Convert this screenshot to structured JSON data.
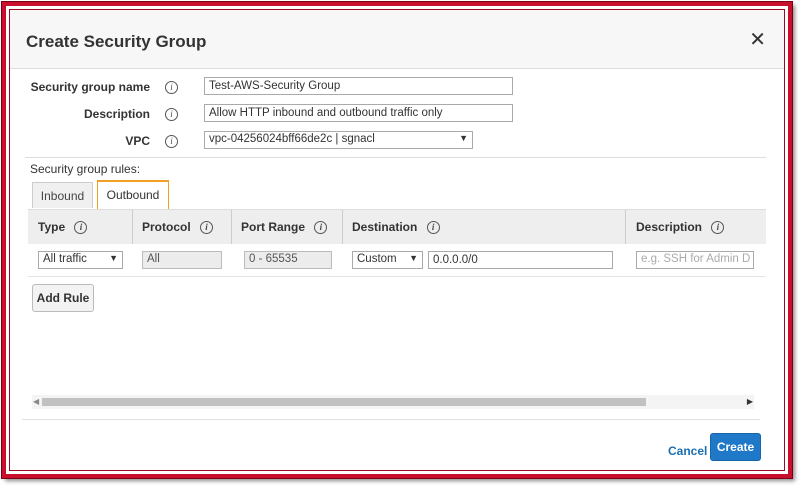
{
  "dialog": {
    "title": "Create Security Group",
    "close_symbol": "✕"
  },
  "form": {
    "name_label": "Security group name",
    "name_value": "Test-AWS-Security Group",
    "description_label": "Description",
    "description_value": "Allow HTTP inbound and outbound traffic only",
    "vpc_label": "VPC",
    "vpc_value": "vpc-04256024bff66de2c | sgnacl"
  },
  "rules": {
    "label": "Security group rules:",
    "tabs": [
      {
        "label": "Inbound",
        "active": false
      },
      {
        "label": "Outbound",
        "active": true
      }
    ],
    "columns": [
      "Type",
      "Protocol",
      "Port Range",
      "Destination",
      "Description"
    ],
    "row": {
      "type": "All traffic",
      "protocol": "All",
      "port_range": "0 - 65535",
      "destination_mode": "Custom",
      "destination_value": "0.0.0.0/0",
      "description_placeholder": "e.g. SSH for Admin D"
    },
    "add_rule_label": "Add Rule"
  },
  "footer": {
    "cancel_label": "Cancel",
    "create_label": "Create"
  },
  "colors": {
    "frame": "#c8102e",
    "tab_accent": "#f0a020",
    "primary": "#1f78c8",
    "link": "#1a6fb4"
  },
  "icons": {
    "info": "info-icon",
    "close": "close-icon",
    "caret": "chevron-down-icon"
  }
}
